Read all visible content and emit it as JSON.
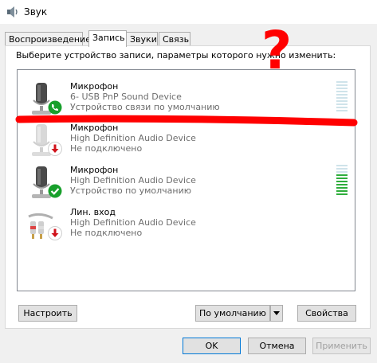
{
  "window": {
    "title": "Звук",
    "icon": "speaker-icon"
  },
  "tabs": [
    {
      "label": "Воспроизведение",
      "active": false
    },
    {
      "label": "Запись",
      "active": true
    },
    {
      "label": "Звуки",
      "active": false
    },
    {
      "label": "Связь",
      "active": false
    }
  ],
  "instruction": "Выберите устройство записи, параметры которого нужно изменить:",
  "devices": [
    {
      "name": "Микрофон",
      "device": "6- USB PnP Sound Device",
      "status": "Устройство связи по умолчанию",
      "icon": "microphone-icon",
      "badge": "phone-badge-icon",
      "badge_color": "#18a02c",
      "meter_level": 0.0
    },
    {
      "name": "Микрофон",
      "device": "High Definition Audio Device",
      "status": "Не подключено",
      "icon": "microphone-icon",
      "badge": "down-arrow-badge-icon",
      "badge_color": "#d0121a",
      "meter_level": null
    },
    {
      "name": "Микрофон",
      "device": "High Definition Audio Device",
      "status": "Устройство по умолчанию",
      "icon": "microphone-icon",
      "badge": "check-badge-icon",
      "badge_color": "#18a02c",
      "meter_level": 0.7
    },
    {
      "name": "Лин. вход",
      "device": "High Definition Audio Device",
      "status": "Не подключено",
      "icon": "line-in-icon",
      "badge": "down-arrow-badge-icon",
      "badge_color": "#d0121a",
      "meter_level": null
    }
  ],
  "buttons": {
    "configure": "Настроить",
    "default": "По умолчанию",
    "properties": "Свойства",
    "ok": "OK",
    "cancel": "Отмена",
    "apply": "Применить"
  },
  "annotations": {
    "question_mark": "?",
    "color": "#ff0000"
  }
}
